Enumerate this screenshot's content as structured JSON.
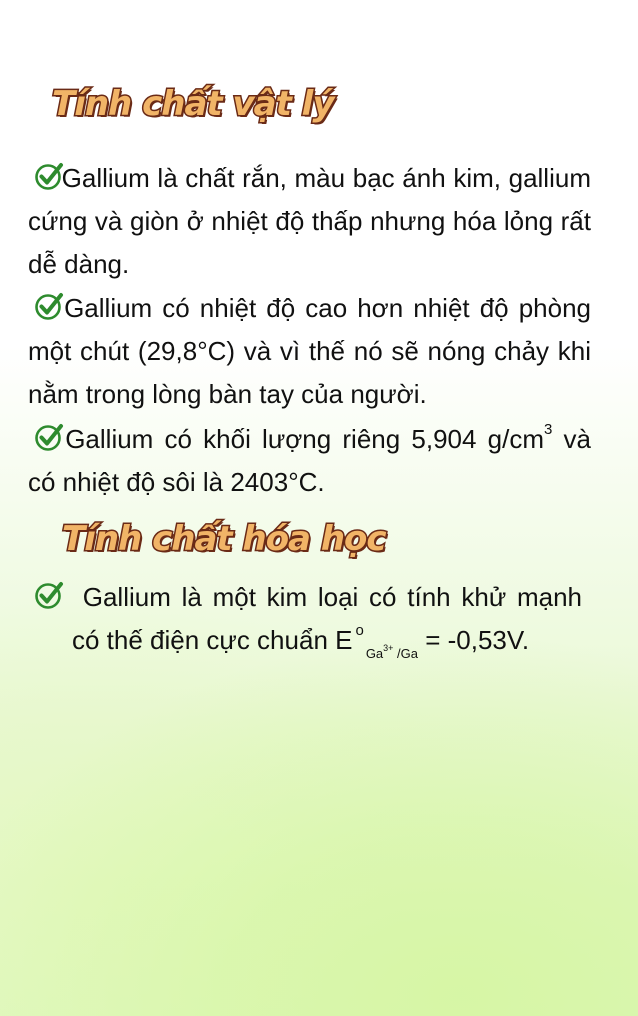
{
  "section_physical": {
    "title": "Tính chất vật lý",
    "items": [
      {
        "text": "Gallium là chất rắn, màu bạc ánh kim, gallium cứng và giòn ở nhiệt độ thấp nhưng hóa lỏng rất dễ dàng."
      },
      {
        "text": "Gallium có nhiệt độ cao hơn nhiệt độ phòng một chút (29,8°C) và vì thế nó sẽ nóng chảy khi nằm trong lòng bàn tay của người."
      },
      {
        "text_before": "Gallium có khối lượng riêng 5,904 g/cm",
        "superscript": "3",
        "text_after": " và có nhiệt độ sôi là 2403°C."
      }
    ]
  },
  "section_chemical": {
    "title": "Tính chất hóa học",
    "items": [
      {
        "text_before": "Gallium là một kim loại có tính khử mạnh có thế điện cực chuẩn E",
        "superscript": "o",
        "sub_element": "Ga",
        "sub_ion": "3+",
        "sub_rest": " /Ga",
        "text_after": " = -0,53V."
      }
    ]
  },
  "icons": {
    "bullet": "check-circle-icon",
    "check_color": "#2e8b2e"
  },
  "colors": {
    "heading_fill": "#f1b467",
    "heading_outline": "#6a2a16",
    "background_tint": "#dff7c0"
  }
}
